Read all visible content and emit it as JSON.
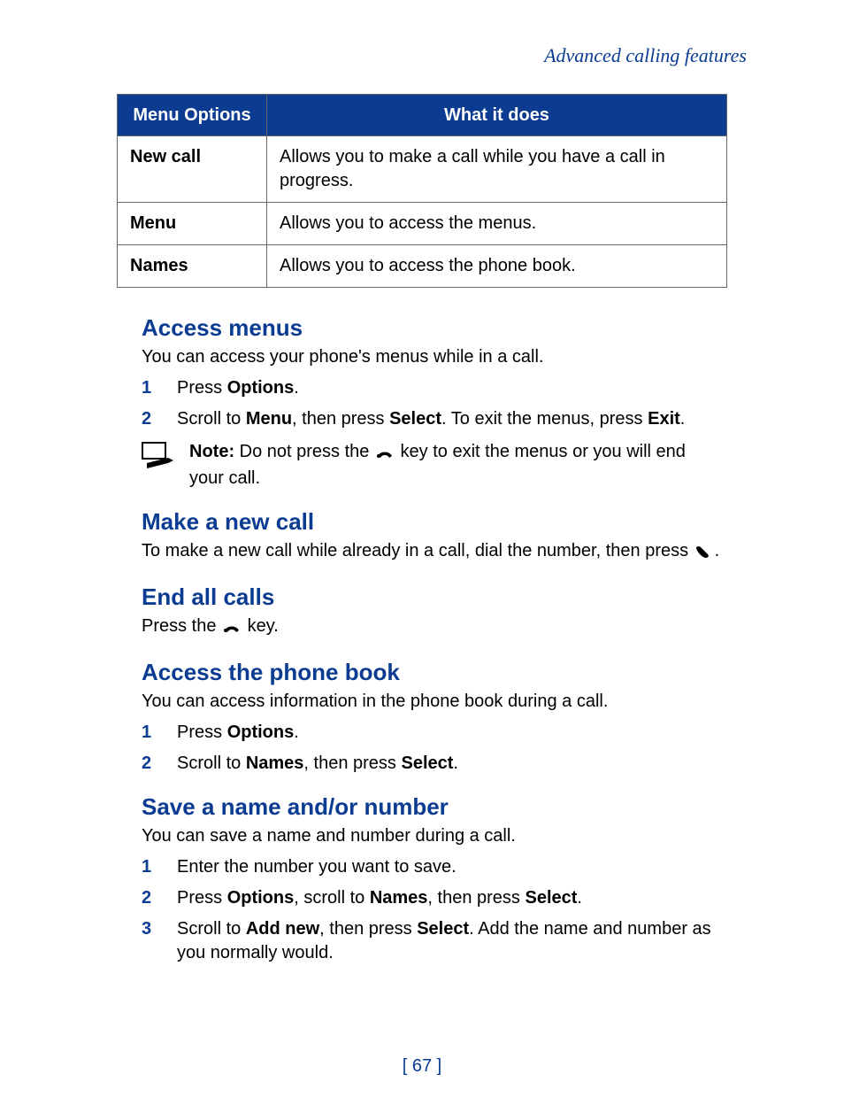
{
  "header": "Advanced calling features",
  "table": {
    "head": {
      "c1": "Menu Options",
      "c2": "What it does"
    },
    "rows": [
      {
        "opt": "New call",
        "desc": "Allows you to make a call while you have a call in progress."
      },
      {
        "opt": "Menu",
        "desc": "Allows you to access the menus."
      },
      {
        "opt": "Names",
        "desc": "Allows you to access the phone book."
      }
    ]
  },
  "s1": {
    "title": "Access menus",
    "intro": "You can access your phone's menus while in a call.",
    "step1_a": "Press ",
    "step1_b": "Options",
    "step1_c": ".",
    "step2_a": "Scroll to ",
    "step2_b": "Menu",
    "step2_c": ", then press ",
    "step2_d": "Select",
    "step2_e": ". To exit the menus, press ",
    "step2_f": "Exit",
    "step2_g": ".",
    "note_label": "Note:",
    "note_a": "  Do not press the ",
    "note_b": " key to exit the menus or you will end your call."
  },
  "s2": {
    "title": "Make a new call",
    "line_a": "To make a new call while already in a call, dial the number, then press ",
    "line_b": "."
  },
  "s3": {
    "title": "End all calls",
    "line_a": "Press the ",
    "line_b": " key."
  },
  "s4": {
    "title": "Access the phone book",
    "intro": "You can access information in the phone book during a call.",
    "step1_a": "Press ",
    "step1_b": "Options",
    "step1_c": ".",
    "step2_a": "Scroll to ",
    "step2_b": "Names",
    "step2_c": ", then press ",
    "step2_d": "Select",
    "step2_e": "."
  },
  "s5": {
    "title": "Save a name and/or number",
    "intro": "You can save a name and number during a call.",
    "step1": "Enter the number you want to save.",
    "step2_a": "Press ",
    "step2_b": "Options",
    "step2_c": ", scroll to ",
    "step2_d": "Names",
    "step2_e": ", then press ",
    "step2_f": "Select",
    "step2_g": ".",
    "step3_a": "Scroll to ",
    "step3_b": "Add new",
    "step3_c": ", then press ",
    "step3_d": "Select",
    "step3_e": ". Add the name and number as you normally would."
  },
  "page_number": "[ 67 ]"
}
